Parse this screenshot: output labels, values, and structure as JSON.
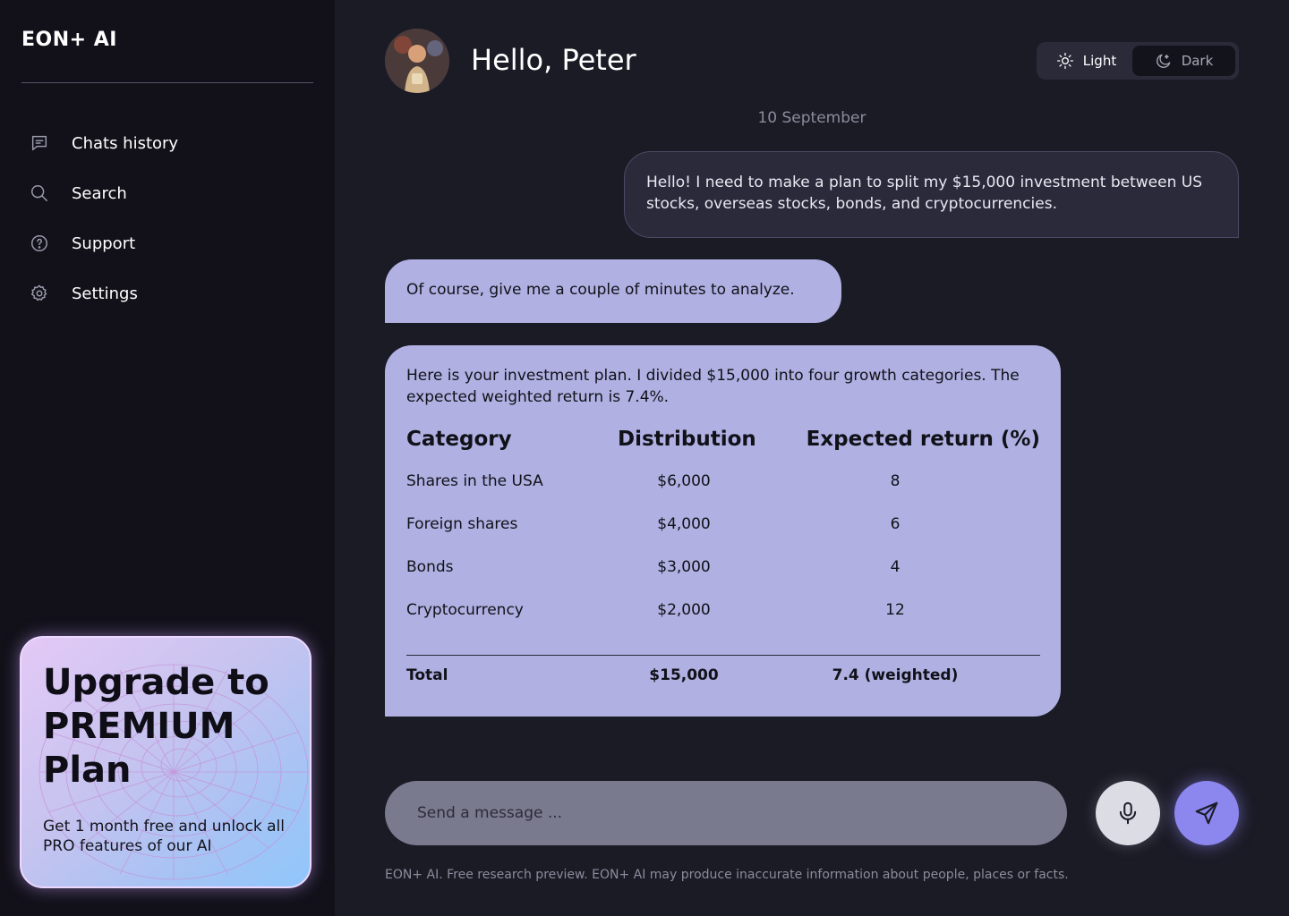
{
  "app": {
    "brand": "EON+ AI"
  },
  "sidebar": {
    "items": [
      {
        "label": "Chats history",
        "icon": "chat-icon"
      },
      {
        "label": "Search",
        "icon": "search-icon"
      },
      {
        "label": "Support",
        "icon": "help-icon"
      },
      {
        "label": "Settings",
        "icon": "gear-icon"
      }
    ],
    "promo": {
      "title": "Upgrade to PREMIUM Plan",
      "text": "Get 1 month free and unlock all PRO features of our AI"
    }
  },
  "header": {
    "greeting": "Hello, Peter",
    "theme": {
      "light_label": "Light",
      "dark_label": "Dark",
      "selected": "Dark"
    }
  },
  "chat": {
    "date": "10 September",
    "messages": [
      {
        "from": "user",
        "text": "Hello! I need to make a plan to split my $15,000 investment between US stocks, overseas stocks, bonds, and cryptocurrencies."
      },
      {
        "from": "ai",
        "text": "Of course, give me a couple of minutes to analyze."
      },
      {
        "from": "ai",
        "text": "Here is your investment plan. I divided $15,000 into four growth categories. The expected weighted return is 7.4%."
      }
    ],
    "table": {
      "headers": [
        "Category",
        "Distribution",
        "Expected return (%)"
      ],
      "rows": [
        [
          "Shares in the USA",
          "$6,000",
          "8"
        ],
        [
          "Foreign shares",
          "$4,000",
          "6"
        ],
        [
          "Bonds",
          "$3,000",
          "4"
        ],
        [
          "Cryptocurrency",
          "$2,000",
          "12"
        ]
      ],
      "total": [
        "Total",
        "$15,000",
        "7.4 (weighted)"
      ]
    }
  },
  "composer": {
    "placeholder": "Send a message ...",
    "value": ""
  },
  "footer": {
    "disclaimer": "EON+ AI. Free research preview. EON+ AI may produce inaccurate information about people, places or facts."
  },
  "colors": {
    "background": "#1b1b26",
    "sidebar": "#121119",
    "ai_bubble": "#b0b0e2",
    "user_bubble": "#2a2a3b",
    "send_button": "#8c86ef"
  }
}
